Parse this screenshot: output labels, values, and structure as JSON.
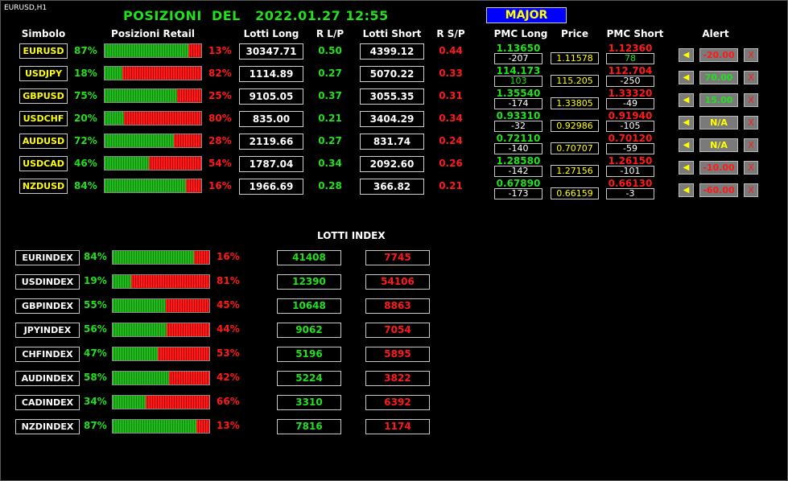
{
  "chart_label": "EURUSD,H1",
  "title": "POSIZIONI  DEL   2022.01.27 12:55",
  "major_button": "MAJOR",
  "headers": {
    "simbolo": "Simbolo",
    "posizioni_retail": "Posizioni Retail",
    "lotti_long": "Lotti Long",
    "r_lp": "R L/P",
    "lotti_short": "Lotti Short",
    "r_sp": "R S/P",
    "pmc_long": "PMC Long",
    "price": "Price",
    "pmc_short": "PMC Short",
    "alert": "Alert"
  },
  "major_rows": [
    {
      "symbol": "EURUSD",
      "long_pct": "87%",
      "short_pct": "13%",
      "long_frac": 0.87,
      "lotti_long": "30347.71",
      "r_lp": "0.50",
      "lotti_short": "4399.12",
      "r_sp": "0.44",
      "pmc_long": "1.13650",
      "pmc_long_diff": "-207",
      "price": "1.11578",
      "pmc_short": "1.12360",
      "pmc_short_diff": "78",
      "pmc_short_diff_color": "#22e01e",
      "bell": "◀",
      "alert": "-20.00",
      "alert_color": "#ff1a1a",
      "close": "X"
    },
    {
      "symbol": "USDJPY",
      "long_pct": "18%",
      "short_pct": "82%",
      "long_frac": 0.18,
      "lotti_long": "1114.89",
      "r_lp": "0.27",
      "lotti_short": "5070.22",
      "r_sp": "0.33",
      "pmc_long": "114.173",
      "pmc_long_diff": "103",
      "pmc_long_diff_color": "#22e01e",
      "price": "115.205",
      "pmc_short": "112.704",
      "pmc_short_diff": "-250",
      "bell": "◀",
      "alert": "70.00",
      "alert_color": "#22e01e",
      "close": "X"
    },
    {
      "symbol": "GBPUSD",
      "long_pct": "75%",
      "short_pct": "25%",
      "long_frac": 0.75,
      "lotti_long": "9105.05",
      "r_lp": "0.37",
      "lotti_short": "3055.35",
      "r_sp": "0.31",
      "pmc_long": "1.35540",
      "pmc_long_diff": "-174",
      "price": "1.33805",
      "pmc_short": "1.33320",
      "pmc_short_diff": "-49",
      "bell": "◀",
      "alert": "15.00",
      "alert_color": "#22e01e",
      "close": "X"
    },
    {
      "symbol": "USDCHF",
      "long_pct": "20%",
      "short_pct": "80%",
      "long_frac": 0.2,
      "lotti_long": "835.00",
      "r_lp": "0.21",
      "lotti_short": "3404.29",
      "r_sp": "0.34",
      "pmc_long": "0.93310",
      "pmc_long_diff": "-32",
      "price": "0.92986",
      "pmc_short": "0.91940",
      "pmc_short_diff": "-105",
      "bell": "◀",
      "alert": "N/A",
      "alert_color": "#ffff00",
      "close": "X"
    },
    {
      "symbol": "AUDUSD",
      "long_pct": "72%",
      "short_pct": "28%",
      "long_frac": 0.72,
      "lotti_long": "2119.66",
      "r_lp": "0.27",
      "lotti_short": "831.74",
      "r_sp": "0.24",
      "pmc_long": "0.72110",
      "pmc_long_diff": "-140",
      "price": "0.70707",
      "pmc_short": "0.70120",
      "pmc_short_diff": "-59",
      "bell": "◀",
      "alert": "N/A",
      "alert_color": "#ffff00",
      "close": "X"
    },
    {
      "symbol": "USDCAD",
      "long_pct": "46%",
      "short_pct": "54%",
      "long_frac": 0.46,
      "lotti_long": "1787.04",
      "r_lp": "0.34",
      "lotti_short": "2092.60",
      "r_sp": "0.26",
      "pmc_long": "1.28580",
      "pmc_long_diff": "-142",
      "price": "1.27156",
      "pmc_short": "1.26150",
      "pmc_short_diff": "-101",
      "bell": "◀",
      "alert": "-10.00",
      "alert_color": "#ff1a1a",
      "close": "X"
    },
    {
      "symbol": "NZDUSD",
      "long_pct": "84%",
      "short_pct": "16%",
      "long_frac": 0.84,
      "lotti_long": "1966.69",
      "r_lp": "0.28",
      "lotti_short": "366.82",
      "r_sp": "0.21",
      "pmc_long": "0.67890",
      "pmc_long_diff": "-173",
      "price": "0.66159",
      "pmc_short": "0.66130",
      "pmc_short_diff": "-3",
      "bell": "◀",
      "alert": "-60.00",
      "alert_color": "#ff1a1a",
      "close": "X"
    }
  ],
  "lotti_index_title": "LOTTI INDEX",
  "index_rows": [
    {
      "name": "EURINDEX",
      "long_pct": "84%",
      "short_pct": "16%",
      "long_frac": 0.84,
      "long_lots": "41408",
      "short_lots": "7745"
    },
    {
      "name": "USDINDEX",
      "long_pct": "19%",
      "short_pct": "81%",
      "long_frac": 0.19,
      "long_lots": "12390",
      "short_lots": "54106"
    },
    {
      "name": "GBPINDEX",
      "long_pct": "55%",
      "short_pct": "45%",
      "long_frac": 0.55,
      "long_lots": "10648",
      "short_lots": "8863"
    },
    {
      "name": "JPYINDEX",
      "long_pct": "56%",
      "short_pct": "44%",
      "long_frac": 0.56,
      "long_lots": "9062",
      "short_lots": "7054"
    },
    {
      "name": "CHFINDEX",
      "long_pct": "47%",
      "short_pct": "53%",
      "long_frac": 0.47,
      "long_lots": "5196",
      "short_lots": "5895"
    },
    {
      "name": "AUDINDEX",
      "long_pct": "58%",
      "short_pct": "42%",
      "long_frac": 0.58,
      "long_lots": "5224",
      "short_lots": "3822"
    },
    {
      "name": "CADINDEX",
      "long_pct": "34%",
      "short_pct": "66%",
      "long_frac": 0.34,
      "long_lots": "3310",
      "short_lots": "6392"
    },
    {
      "name": "NZDINDEX",
      "long_pct": "87%",
      "short_pct": "13%",
      "long_frac": 0.87,
      "long_lots": "7816",
      "short_lots": "1174"
    }
  ],
  "colors": {
    "green": "#22e01e",
    "red": "#ff1a1a",
    "yellow": "#ffff00",
    "major_bg": "#0000ff"
  }
}
